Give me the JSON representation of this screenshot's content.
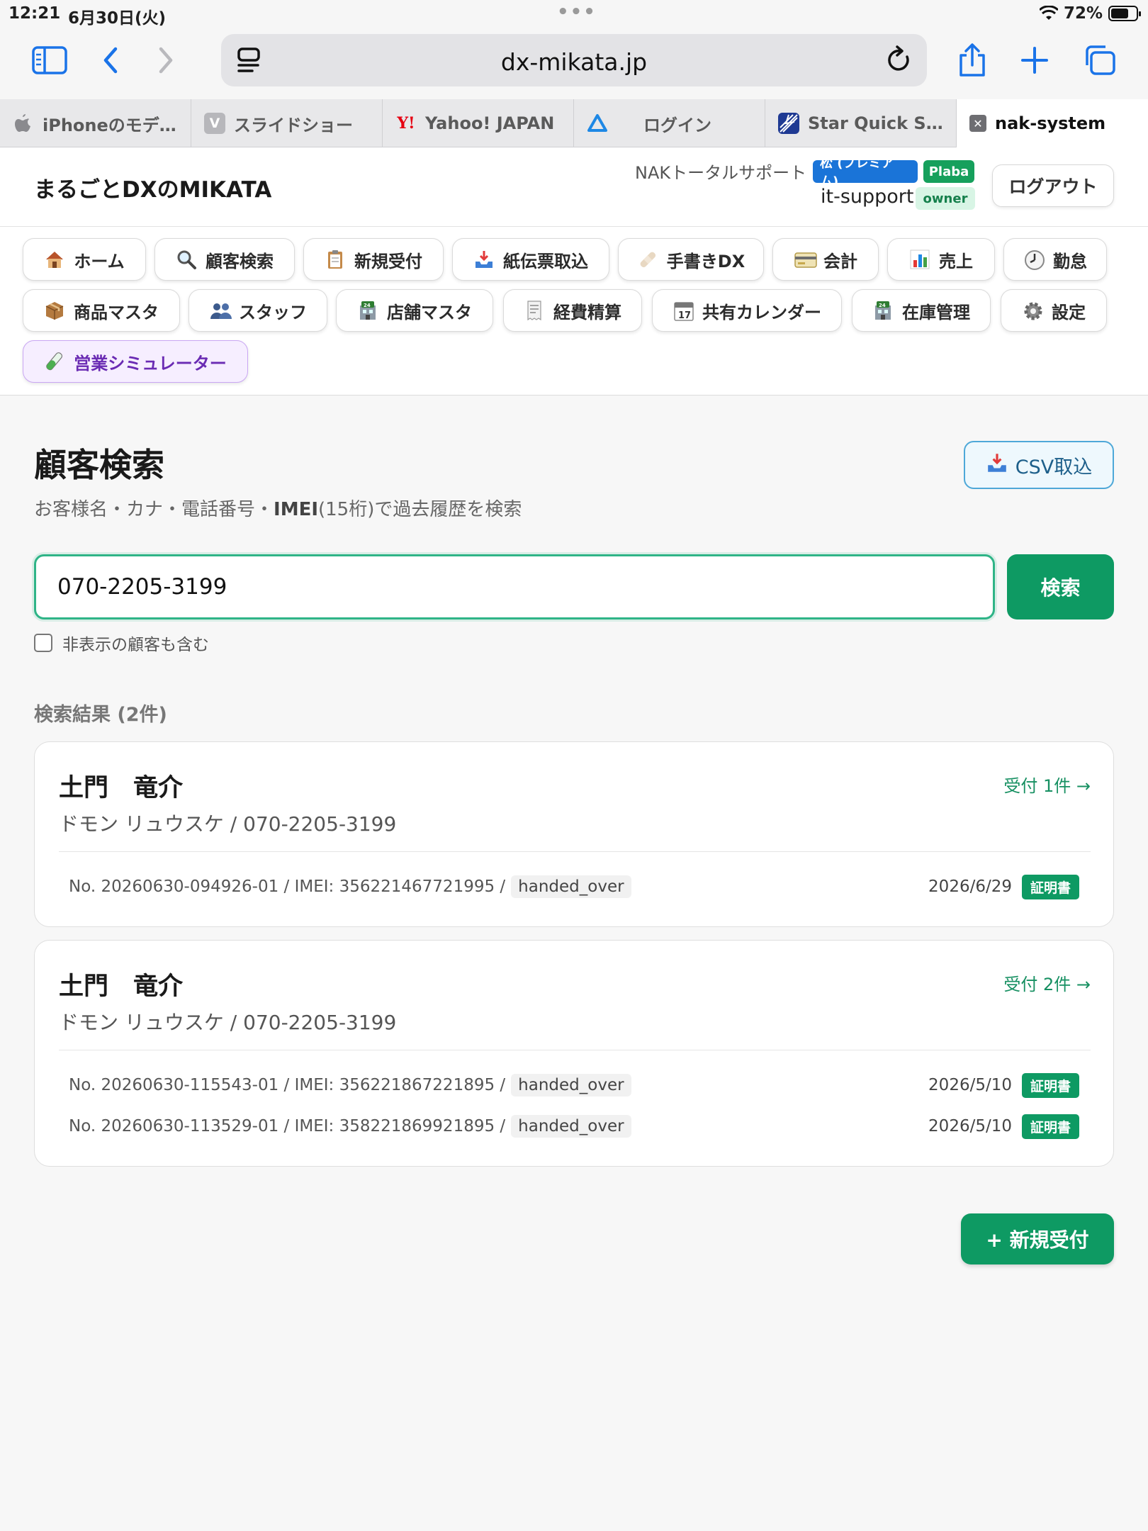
{
  "status_bar": {
    "time": "12:21",
    "date": "6月30日(火)",
    "battery": "72%",
    "battery_level": 0.72
  },
  "browser": {
    "url": "dx-mikata.jp",
    "tabs": [
      {
        "label": "iPhoneのモデ…",
        "icon": "apple-icon",
        "active": false
      },
      {
        "label": "スライドショー",
        "icon": "v-icon",
        "active": false
      },
      {
        "label": "Yahoo! JAPAN",
        "icon": "yahoo-icon",
        "active": false
      },
      {
        "label": "ログイン",
        "icon": "triangle-icon",
        "active": false
      },
      {
        "label": "Star Quick S…",
        "icon": "star-quick-icon",
        "active": false
      },
      {
        "label": "nak-system",
        "icon": "close-icon",
        "active": true
      }
    ]
  },
  "header": {
    "brand": "まるごとDXのMIKATA",
    "org": "NAKトータルサポート",
    "plan_badge": "松 (プレミアム)",
    "plan_badge2": "Plaba",
    "user": "it-support",
    "role": "owner",
    "logout": "ログアウト"
  },
  "nav": {
    "items": [
      {
        "label": "ホーム",
        "icon": "house-icon"
      },
      {
        "label": "顧客検索",
        "icon": "magnifier-icon"
      },
      {
        "label": "新規受付",
        "icon": "clipboard-icon"
      },
      {
        "label": "紙伝票取込",
        "icon": "inbox-tray-icon"
      },
      {
        "label": "手書きDX",
        "icon": "bandage-icon"
      },
      {
        "label": "会計",
        "icon": "credit-card-icon"
      },
      {
        "label": "売上",
        "icon": "bar-chart-icon"
      },
      {
        "label": "勤怠",
        "icon": "clock-icon"
      },
      {
        "label": "商品マスタ",
        "icon": "package-icon"
      },
      {
        "label": "スタッフ",
        "icon": "people-icon"
      },
      {
        "label": "店舗マスタ",
        "icon": "store-icon"
      },
      {
        "label": "経費精算",
        "icon": "receipt-icon"
      },
      {
        "label": "共有カレンダー",
        "icon": "calendar-icon"
      },
      {
        "label": "在庫管理",
        "icon": "store-icon"
      },
      {
        "label": "設定",
        "icon": "gear-icon"
      },
      {
        "label": "営業シミュレーター",
        "icon": "test-tube-icon"
      }
    ]
  },
  "main": {
    "title": "顧客検索",
    "subtitle_pre": "お客様名・カナ・電話番号・",
    "subtitle_bold": "IMEI",
    "subtitle_post": "(15桁)で過去履歴を検索",
    "csv_button": "CSV取込",
    "search_value": "070-2205-3199",
    "search_button": "検索",
    "hidden_checkbox": "非表示の顧客も含む",
    "hidden_checked": false,
    "result_count": "検索結果 (2件)",
    "new_button": "+ 新規受付",
    "colors": {
      "accent": "#0e9a63",
      "focus": "#2fb487"
    }
  },
  "results": [
    {
      "name": "土門　竜介",
      "kana_phone": "ドモン リュウスケ / 070-2205-3199",
      "link": "受付 1件 →",
      "records": [
        {
          "info": "No. 20260630-094926-01 / IMEI: 356221467721995 /",
          "status": "handed_over",
          "date": "2026/6/29",
          "cert": "証明書"
        }
      ]
    },
    {
      "name": "土門　竜介",
      "kana_phone": "ドモン リュウスケ / 070-2205-3199",
      "link": "受付 2件 →",
      "records": [
        {
          "info": "No. 20260630-115543-01 / IMEI: 356221867221895 /",
          "status": "handed_over",
          "date": "2026/5/10",
          "cert": "証明書"
        },
        {
          "info": "No. 20260630-113529-01 / IMEI: 358221869921895 /",
          "status": "handed_over",
          "date": "2026/5/10",
          "cert": "証明書"
        }
      ]
    }
  ]
}
